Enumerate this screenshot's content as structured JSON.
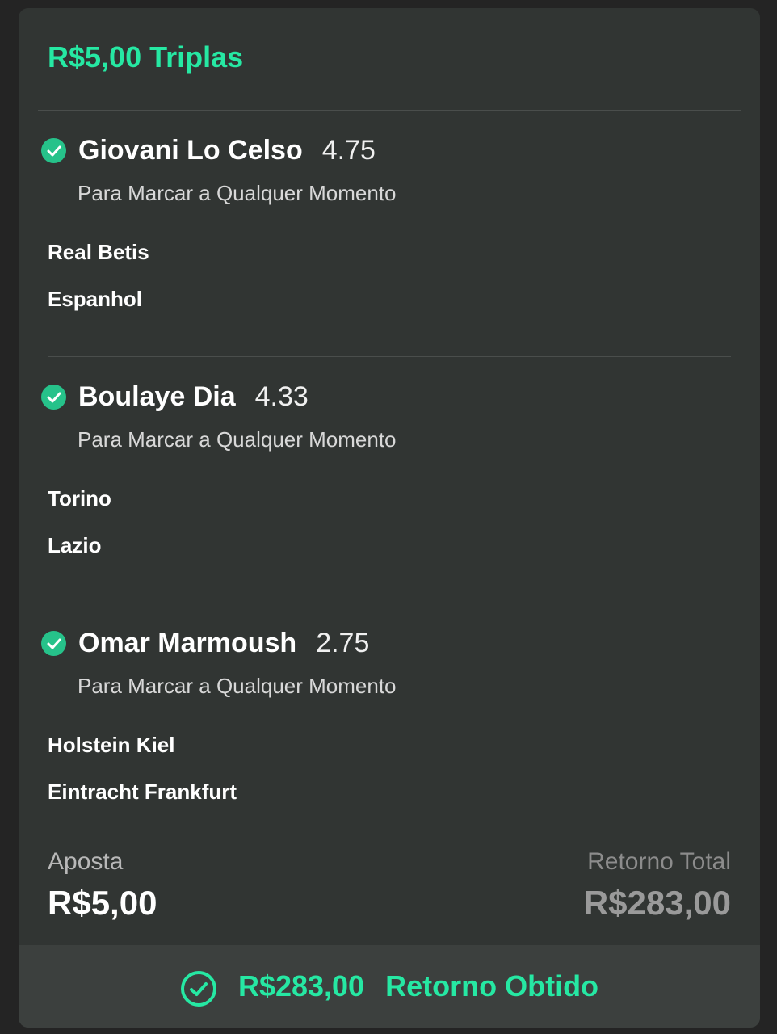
{
  "bet": {
    "title": "R$5,00 Triplas",
    "selections": [
      {
        "player": "Giovani Lo Celso",
        "odds": "4.75",
        "market": "Para Marcar a Qualquer Momento",
        "team_home": "Real Betis",
        "team_away": "Espanhol"
      },
      {
        "player": "Boulaye Dia",
        "odds": "4.33",
        "market": "Para Marcar a Qualquer Momento",
        "team_home": "Torino",
        "team_away": "Lazio"
      },
      {
        "player": "Omar Marmoush",
        "odds": "2.75",
        "market": "Para Marcar a Qualquer Momento",
        "team_home": "Holstein Kiel",
        "team_away": "Eintracht Frankfurt"
      }
    ],
    "stake_label": "Aposta",
    "stake_value": "R$5,00",
    "return_label": "Retorno Total",
    "return_value": "R$283,00",
    "result_amount": "R$283,00",
    "result_text": "Retorno Obtido"
  },
  "colors": {
    "accent": "#26e8a3",
    "card": "#313533",
    "background": "#242424",
    "check": "#26c28a"
  },
  "icons": {
    "selection": "check-circle-icon",
    "result": "check-circle-outline-icon"
  }
}
